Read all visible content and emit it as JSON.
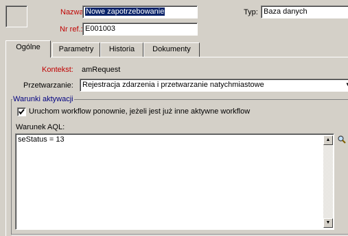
{
  "header": {
    "name_label": "Nazwa:",
    "name_value": "Nowe zapotrzebowanie",
    "ref_label": "Nr ref.:",
    "ref_value": "E001003",
    "type_label": "Typ:",
    "type_value": "Baza danych"
  },
  "tabs": [
    "Ogólne",
    "Parametry",
    "Historia",
    "Dokumenty"
  ],
  "general": {
    "context_label": "Kontekst:",
    "context_value": "amRequest",
    "processing_label": "Przetwarzanie:",
    "processing_value": "Rejestracja zdarzenia i przetwarzanie natychmiastowe"
  },
  "activation": {
    "group_title": "Warunki aktywacji",
    "restart_checkbox_label": "Uruchom workflow ponownie, jeżeli jest już inne aktywne workflow",
    "restart_checked": true,
    "aql_label": "Warunek AQL:",
    "aql_value": "seStatus = 13"
  },
  "colors": {
    "window_bg": "#d4d0c8",
    "required_label": "#c00000",
    "selection": "#0a246a",
    "group_title": "#000080"
  }
}
